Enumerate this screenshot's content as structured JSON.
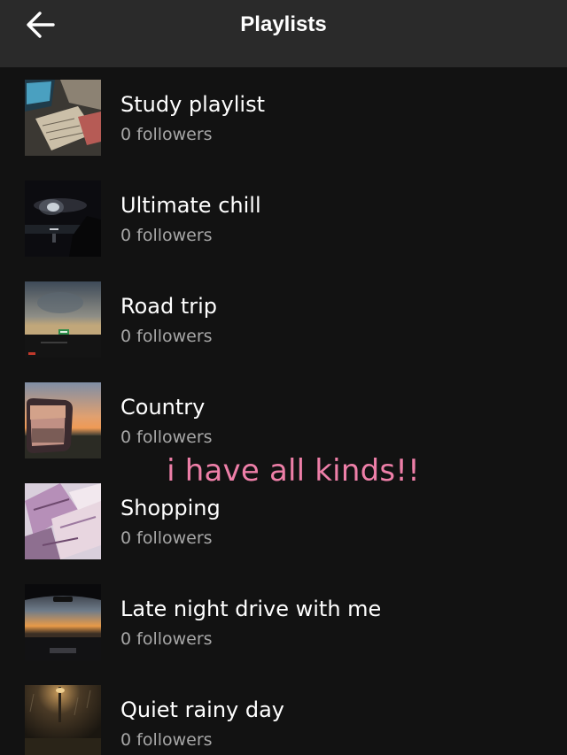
{
  "header": {
    "title": "Playlists",
    "back_icon": "arrow-left-icon"
  },
  "playlists": [
    {
      "title": "Study playlist",
      "followers": "0 followers",
      "artwork": "desk-with-laptop-and-notes"
    },
    {
      "title": "Ultimate chill",
      "followers": "0 followers",
      "artwork": "moon-over-water-at-night"
    },
    {
      "title": "Road trip",
      "followers": "0 followers",
      "artwork": "dusk-highway-with-sign"
    },
    {
      "title": "Country",
      "followers": "0 followers",
      "artwork": "sunset-in-side-mirror"
    },
    {
      "title": "Shopping",
      "followers": "0 followers",
      "artwork": "pink-shopping-bags"
    },
    {
      "title": "Late night drive with me",
      "followers": "0 followers",
      "artwork": "sunset-through-windshield"
    },
    {
      "title": "Quiet rainy day",
      "followers": "0 followers",
      "artwork": "rainy-street-lamp"
    }
  ],
  "overlay": {
    "caption": "i have all kinds!!",
    "color": "#ee7fa8"
  },
  "colors": {
    "background": "#121212",
    "header": "#2a2a2a",
    "title_text": "#ffffff",
    "subtitle_text": "#a7a7a7"
  }
}
